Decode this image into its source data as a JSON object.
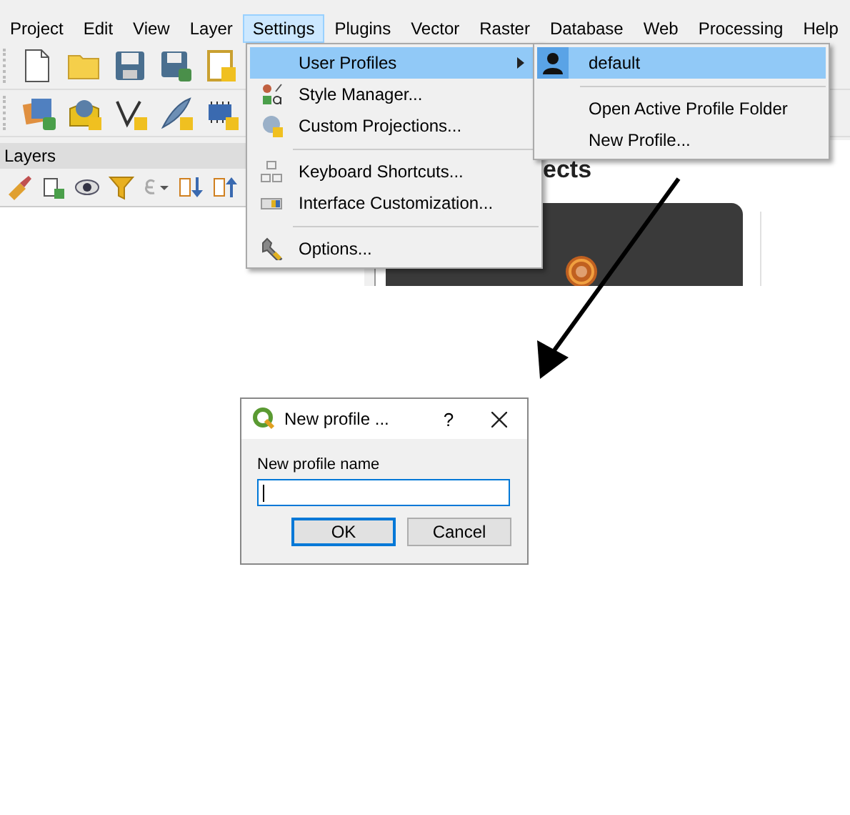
{
  "menubar": [
    {
      "label": "Project",
      "selected": false
    },
    {
      "label": "Edit",
      "selected": false
    },
    {
      "label": "View",
      "selected": false
    },
    {
      "label": "Layer",
      "selected": false
    },
    {
      "label": "Settings",
      "selected": true
    },
    {
      "label": "Plugins",
      "selected": false
    },
    {
      "label": "Vector",
      "selected": false
    },
    {
      "label": "Raster",
      "selected": false
    },
    {
      "label": "Database",
      "selected": false
    },
    {
      "label": "Web",
      "selected": false
    },
    {
      "label": "Processing",
      "selected": false
    },
    {
      "label": "Help",
      "selected": false
    }
  ],
  "settings_menu": {
    "items": [
      {
        "kind": "submenu",
        "label": "User Profiles",
        "selected": true
      },
      {
        "kind": "item",
        "label": "Style Manager...",
        "selected": false
      },
      {
        "kind": "item",
        "label": "Custom Projections...",
        "selected": false
      },
      {
        "kind": "separator"
      },
      {
        "kind": "item",
        "label": "Keyboard Shortcuts...",
        "selected": false
      },
      {
        "kind": "item",
        "label": "Interface Customization...",
        "selected": false
      },
      {
        "kind": "separator"
      },
      {
        "kind": "item",
        "label": "Options...",
        "selected": false
      }
    ]
  },
  "profiles_submenu": {
    "items": [
      {
        "kind": "profile",
        "label": "default",
        "selected": true
      },
      {
        "kind": "separator"
      },
      {
        "kind": "item",
        "label": "Open Active Profile Folder",
        "selected": false
      },
      {
        "kind": "item",
        "label": "New Profile...",
        "selected": false
      }
    ]
  },
  "layers_panel": {
    "title": "Layers"
  },
  "page_heading": "ects",
  "dialog": {
    "title": "New profile ...",
    "help": "?",
    "field_label": "New profile name",
    "buttons": [
      {
        "label": "OK",
        "default": true
      },
      {
        "label": "Cancel",
        "default": false
      }
    ]
  }
}
